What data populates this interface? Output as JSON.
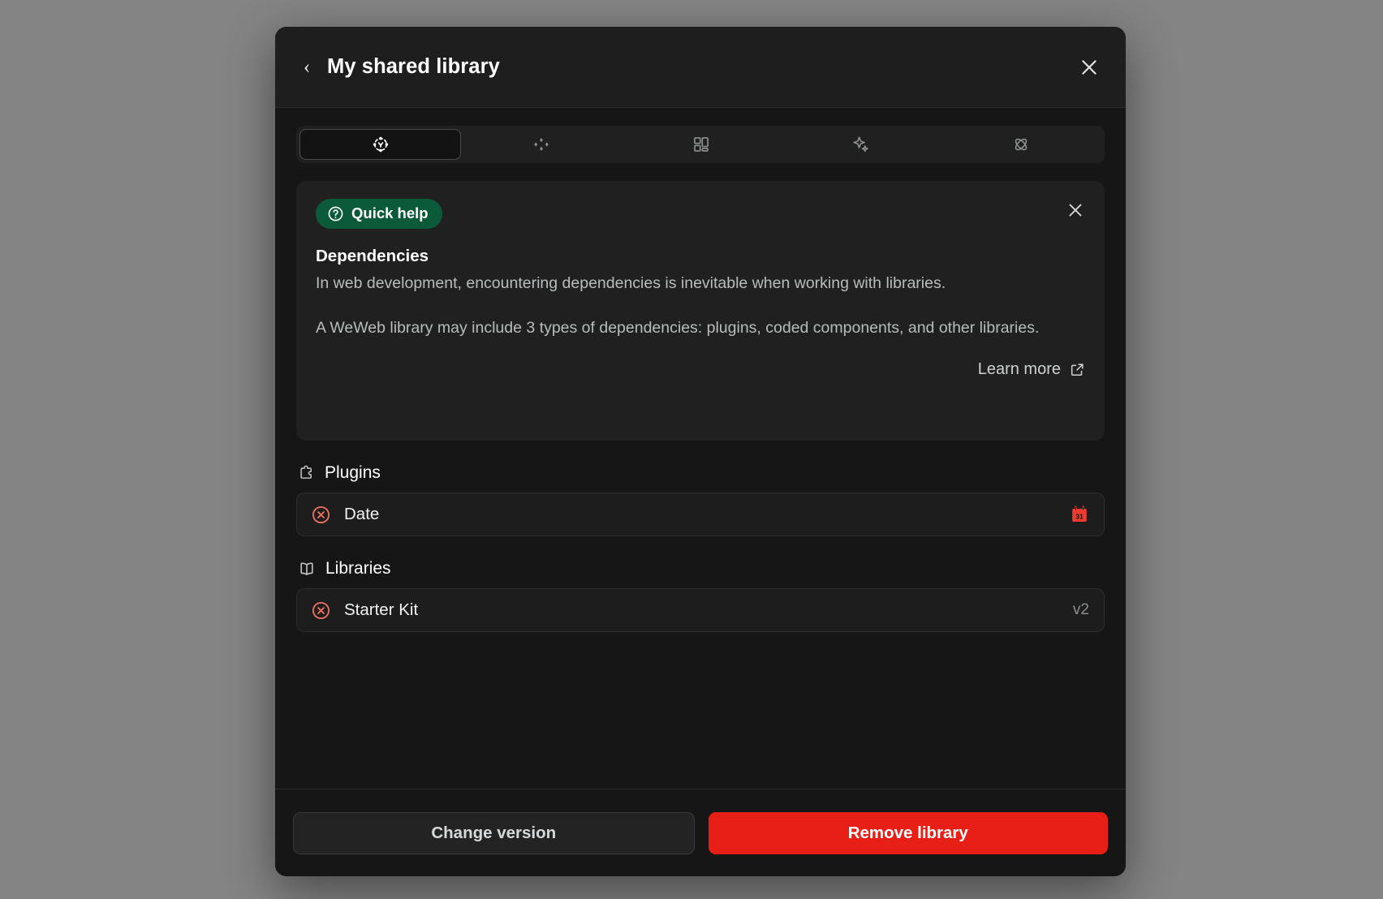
{
  "header": {
    "back_icon": "chevron-left-icon",
    "title": "My shared library",
    "close_icon": "close-icon"
  },
  "tabs": [
    {
      "id": "settings",
      "icon": "circle-nodes-icon",
      "active": true
    },
    {
      "id": "elements",
      "icon": "diamond-cluster-icon",
      "active": false
    },
    {
      "id": "components",
      "icon": "layout-grid-icon",
      "active": false
    },
    {
      "id": "ai",
      "icon": "sparkles-icon",
      "active": false
    },
    {
      "id": "dependencies",
      "icon": "atom-icon",
      "active": false
    }
  ],
  "quick_help": {
    "badge_label": "Quick help",
    "badge_icon": "question-circle-icon",
    "badge_color": "#0b5b3b",
    "close_icon": "close-icon",
    "title": "Dependencies",
    "paragraph_1": "In web development, encountering dependencies is inevitable when working with libraries.",
    "paragraph_2": "A WeWeb library may include 3 types of dependencies: plugins, coded components, and other libraries.",
    "learn_more_label": "Learn more",
    "learn_more_icon": "external-link-icon"
  },
  "sections": [
    {
      "id": "plugins",
      "icon": "puzzle-piece-icon",
      "label": "Plugins",
      "rows": [
        {
          "name": "Date",
          "remove_icon": "circle-x-icon",
          "remove_color": "#e8705f",
          "version": "",
          "trailing_icon": "calendar-31-icon",
          "trailing_color": "#f03c2e"
        }
      ]
    },
    {
      "id": "libraries",
      "icon": "open-book-icon",
      "label": "Libraries",
      "rows": [
        {
          "name": "Starter Kit",
          "remove_icon": "circle-x-icon",
          "remove_color": "#e8705f",
          "version": "v2",
          "trailing_icon": "",
          "trailing_color": ""
        }
      ]
    }
  ],
  "footer": {
    "change_version_label": "Change version",
    "remove_library_label": "Remove library",
    "danger_color": "#e81f16"
  }
}
